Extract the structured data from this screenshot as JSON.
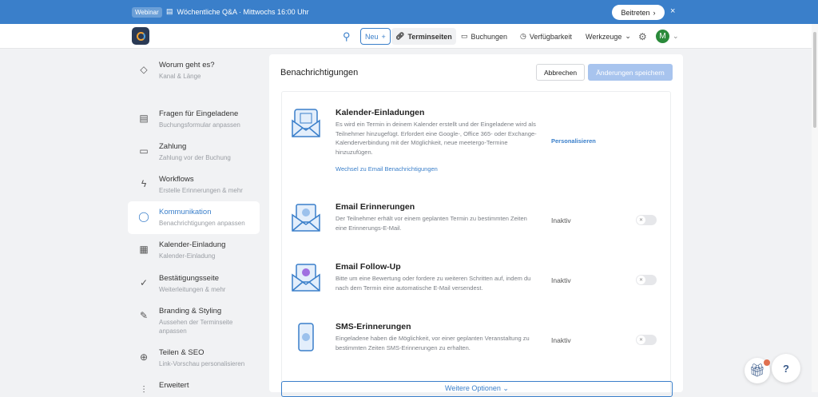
{
  "banner": {
    "badge": "Webinar",
    "text": "Wöchentliche Q&A · Mittwochs 16:00 Uhr",
    "join": "Beitreten",
    "close": "×"
  },
  "nav": {
    "new": "Neu",
    "terminseiten": "Terminseiten",
    "buchungen": "Buchungen",
    "verfuegbarkeit": "Verfügbarkeit",
    "werkzeuge": "Werkzeuge",
    "avatar": "M"
  },
  "sidebar": [
    {
      "title": "Worum geht es?",
      "sub": "Kanal & Länge"
    },
    {
      "title": "Fragen für Eingeladene",
      "sub": "Buchungsformular anpassen"
    },
    {
      "title": "Zahlung",
      "sub": "Zahlung vor der Buchung"
    },
    {
      "title": "Workflows",
      "sub": "Erstelle Erinnerungen & mehr"
    },
    {
      "title": "Kommunikation",
      "sub": "Benachrichtigungen anpassen"
    },
    {
      "title": "Kalender-Einladung",
      "sub": "Kalender-Einladung"
    },
    {
      "title": "Bestätigungsseite",
      "sub": "Weiterleitungen & mehr"
    },
    {
      "title": "Branding & Styling",
      "sub": "Aussehen der Terminseite anpassen"
    },
    {
      "title": "Teilen & SEO",
      "sub": "Link-Vorschau personalisieren"
    },
    {
      "title": "Erweitert",
      "sub": ""
    }
  ],
  "main": {
    "title": "Benachrichtigungen",
    "cancel": "Abbrechen",
    "save": "Änderungen speichern",
    "rows": [
      {
        "title": "Kalender-Einladungen",
        "desc": "Es wird ein Termin in deinem Kalender erstellt und der Eingeladene wird als Teilnehmer hinzugefügt. Erfordert eine Google-, Office 365- oder Exchange-Kalenderverbindung mit der Möglichkeit, neue meetergo-Termine hinzuzufügen.",
        "link": "Wechsel zu Email Benachrichtigungen",
        "action": "Personalisieren"
      },
      {
        "title": "Email Erinnerungen",
        "desc": "Der Teilnehmer erhält vor einem geplanten Termin zu bestimmten Zeiten eine Erinnerungs-E-Mail.",
        "status": "Inaktiv",
        "enabled": false
      },
      {
        "title": "Email Follow-Up",
        "desc": "Bitte um eine Bewertung oder fordere zu weiteren Schritten auf, indem du nach dem Termin eine automatische E-Mail versendest.",
        "status": "Inaktiv",
        "enabled": false
      },
      {
        "title": "SMS-Erinnerungen",
        "desc": "Eingeladene haben die Möglichkeit, vor einer geplanten Veranstaltung zu bestimmten Zeiten SMS-Erinnerungen zu erhalten.",
        "status": "Inaktiv",
        "enabled": false
      }
    ],
    "more": "Weitere Optionen ⌄"
  },
  "help": "?"
}
